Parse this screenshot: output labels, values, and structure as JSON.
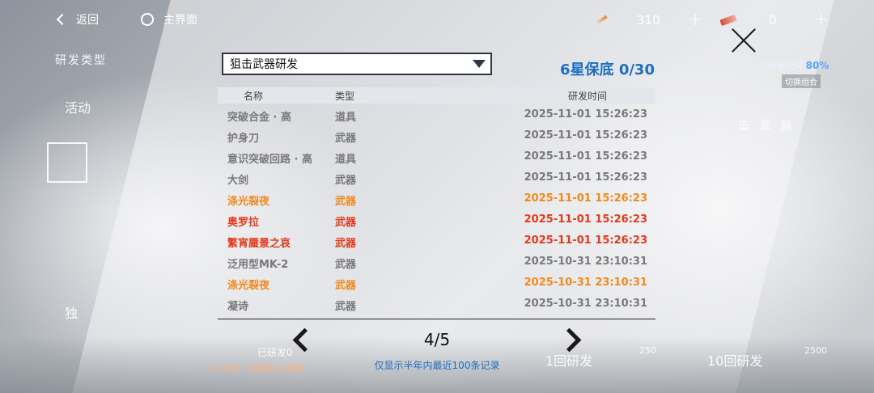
{
  "topbar": {
    "back_label": "返回",
    "home_label": "主界面",
    "currency1": "310",
    "currency2": "0",
    "plus": "+"
  },
  "background": {
    "left_category": "研发类型",
    "left_item_activity": "活动",
    "left_item_bottom": "独",
    "right_hint_prefix": "占6星出率",
    "right_hint_value": "80%",
    "switch_combo": "切换组合",
    "right_weapon_label": "击 武 器",
    "bottom_left_line1": "已研发0",
    "bottom_left_line2": "10 必出 3 星或以上武器",
    "bottom_one_draw": "1回研发",
    "bottom_one_cost": "250",
    "bottom_ten_draw": "10回研发",
    "bottom_ten_cost": "2500"
  },
  "modal": {
    "select_value": "狙击武器研发",
    "pity": "6星保底 0/30",
    "columns": {
      "name": "名称",
      "type": "类型",
      "time": "研发时间"
    },
    "rows": [
      {
        "name": "突破合金 · 高",
        "type": "道具",
        "time": "2025-11-01 15:26:23",
        "rarity": "normal"
      },
      {
        "name": "护身刀",
        "type": "武器",
        "time": "2025-11-01 15:26:23",
        "rarity": "normal"
      },
      {
        "name": "意识突破回路 · 高",
        "type": "道具",
        "time": "2025-11-01 15:26:23",
        "rarity": "normal"
      },
      {
        "name": "大剑",
        "type": "武器",
        "time": "2025-11-01 15:26:23",
        "rarity": "normal"
      },
      {
        "name": "涤光裂夜",
        "type": "武器",
        "time": "2025-11-01 15:26:23",
        "rarity": "orange"
      },
      {
        "name": "奥罗拉",
        "type": "武器",
        "time": "2025-11-01 15:26:23",
        "rarity": "red"
      },
      {
        "name": "繁宵蜃景之哀",
        "type": "武器",
        "time": "2025-11-01 15:26:23",
        "rarity": "red"
      },
      {
        "name": "泛用型MK-2",
        "type": "武器",
        "time": "2025-10-31 23:10:31",
        "rarity": "normal"
      },
      {
        "name": "涤光裂夜",
        "type": "武器",
        "time": "2025-10-31 23:10:31",
        "rarity": "orange"
      },
      {
        "name": "凝诗",
        "type": "武器",
        "time": "2025-10-31 23:10:31",
        "rarity": "normal"
      }
    ],
    "page": "4/5",
    "note": "仅显示半年内最近100条记录"
  },
  "colors": {
    "accent_blue": "#1f6fc0",
    "rarity_orange": "#f08a1c",
    "rarity_red": "#e23a1c",
    "rarity_normal": "#7a7a7a"
  },
  "icons": {
    "back": "chevron-left-icon",
    "home": "circle-icon",
    "close": "close-icon",
    "prev": "chevron-left-icon",
    "next": "chevron-right-icon",
    "dropdown": "caret-down-icon"
  }
}
